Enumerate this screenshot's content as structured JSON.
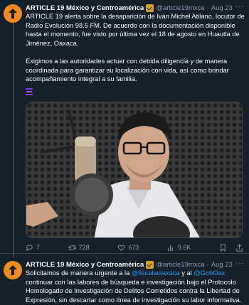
{
  "tweets": [
    {
      "author": "ARTICLE 19 México y Centroamérica",
      "handle": "@article19mxca",
      "separator": "·",
      "date": "Aug 23",
      "paragraphs": [
        "ARTICLE 19 alerta sobre la desaparición de Iván Michel Atilano, locutor de Radio Evolución 98.5 FM. De acuerdo con la documentación disponible hasta el momento, fue visto por última vez el 18 de agosto en Huautla de Jiménez, Oaxaca.",
        "Exigimos a las autoridades actuar con debida diligencia y de manera coordinada para garantizar su localización con vida, así como brindar acompañamiento integral a su familia."
      ],
      "stats": {
        "replies": "7",
        "retweets": "728",
        "likes": "673",
        "views": "9.6K"
      }
    },
    {
      "author": "ARTICLE 19 México y Centroamérica",
      "handle": "@article19mxca",
      "separator": "·",
      "date": "Aug 23",
      "text_a": "Solicitamos de manera urgente a la ",
      "mention_1": "@fiscaliaoaxaca",
      "text_b": " y al ",
      "mention_2": "@GobOax",
      "text_c": " continuar con las labores de búsqueda e investigación bajo el Protocolo Homologado de Investigación de Delitos Cometidos contra la Libertad de Expresión, sin descartar como línea de investigación su labor informativa."
    }
  ],
  "colors": {
    "background": "#15202b",
    "text": "#f7f9f9",
    "muted": "#8b98a5",
    "link": "#1d9bf0",
    "avatar": "#f08a1d",
    "badge": "#d8a31c"
  },
  "icons": [
    "more-icon",
    "verified-badge-icon",
    "reply-icon",
    "retweet-icon",
    "like-icon",
    "views-icon",
    "bookmark-icon",
    "share-icon"
  ]
}
